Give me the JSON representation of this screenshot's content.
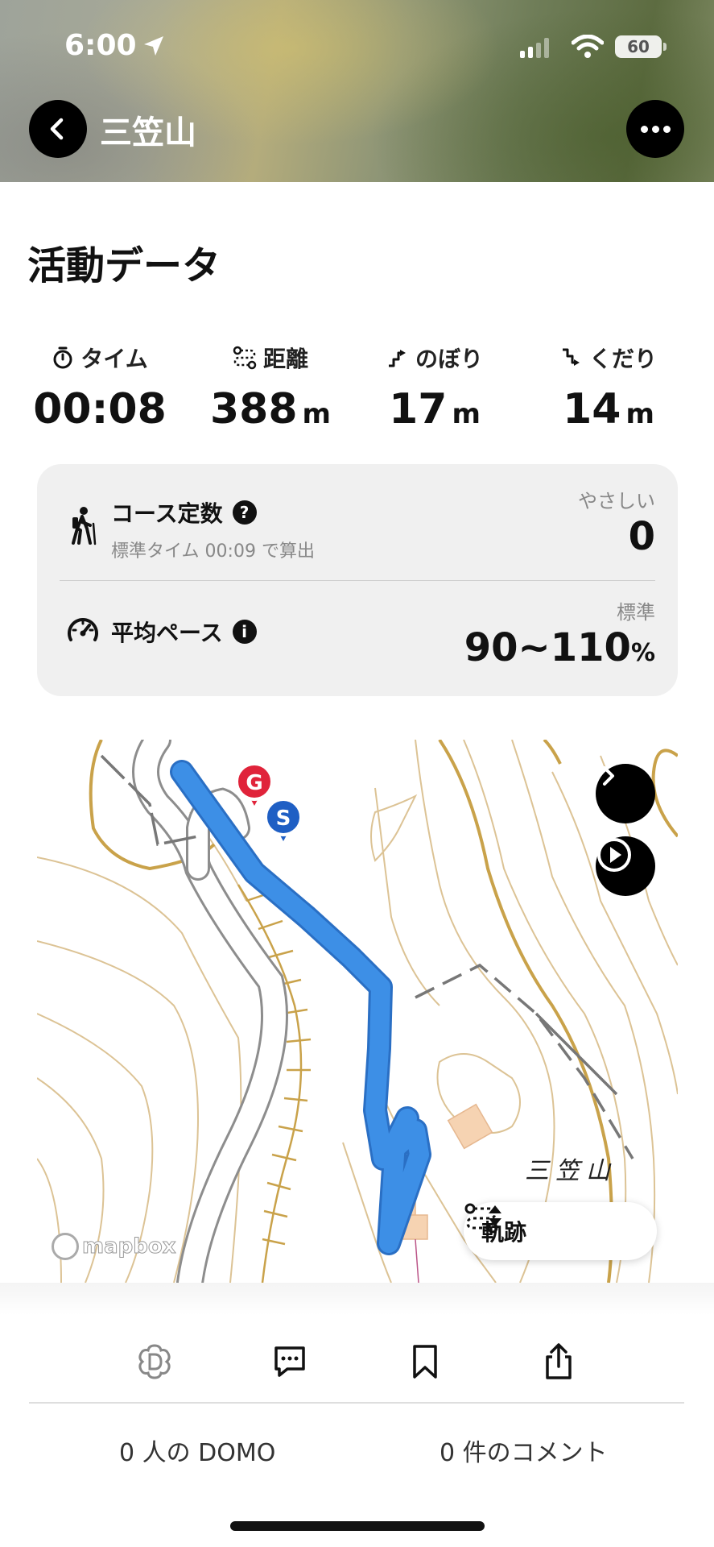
{
  "status_bar": {
    "time": "6:00",
    "battery": "60",
    "icons": [
      "location-arrow-icon",
      "signal-icon",
      "wifi-icon",
      "battery-icon"
    ]
  },
  "header": {
    "title": "三笠山",
    "back_icon": "chevron-left-icon",
    "more_icon": "more-dots-icon"
  },
  "activity": {
    "section_title": "活動データ",
    "stats": [
      {
        "icon": "stopwatch-icon",
        "label": "タイム",
        "value": "00:08",
        "unit": ""
      },
      {
        "icon": "route-icon",
        "label": "距離",
        "value": "388",
        "unit": "m"
      },
      {
        "icon": "ascent-icon",
        "label": "のぼり",
        "value": "17",
        "unit": "m"
      },
      {
        "icon": "descent-icon",
        "label": "くだり",
        "value": "14",
        "unit": "m"
      }
    ]
  },
  "course_card": {
    "course_constant": {
      "title": "コース定数",
      "help_glyph": "?",
      "subtitle": "標準タイム 00:09 で算出",
      "rating_label": "やさしい",
      "value": "0"
    },
    "average_pace": {
      "title": "平均ペース",
      "info_glyph": "i",
      "rating_label": "標準",
      "value": "90~110",
      "unit": "%"
    }
  },
  "map": {
    "peak_label": "三笠山",
    "goal_marker": "G",
    "start_marker": "S",
    "attribution": "mapbox",
    "track_selector": "軌跡",
    "track_color": "#3d8fe6",
    "contour_color": "#c9a24a",
    "goal_color": "#e0233a",
    "start_color": "#1f5fc4"
  },
  "bottom": {
    "actions": [
      "domo-icon",
      "comment-icon",
      "bookmark-icon",
      "share-icon"
    ],
    "domo_count_text": "0 人の DOMO",
    "comment_count_text": "0 件のコメント"
  }
}
